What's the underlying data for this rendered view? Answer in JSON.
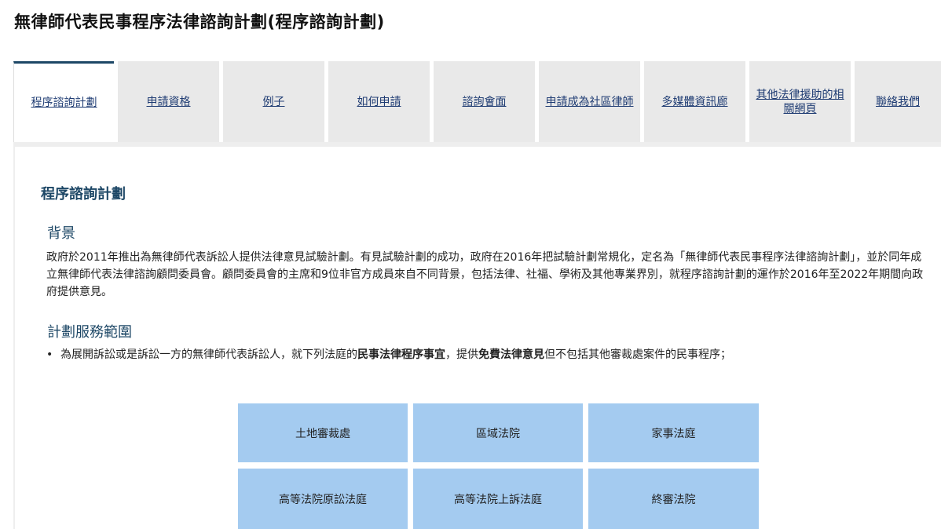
{
  "page": {
    "title": "無律師代表民事程序法律諮詢計劃(程序諮詢計劃)"
  },
  "tabs": [
    {
      "label": "程序諮詢計劃",
      "active": true
    },
    {
      "label": "申請資格",
      "active": false
    },
    {
      "label": "例子",
      "active": false
    },
    {
      "label": "如何申請",
      "active": false
    },
    {
      "label": "諮詢會面",
      "active": false
    },
    {
      "label": "申請成為社區律師",
      "active": false
    },
    {
      "label": "多媒體資訊廊",
      "active": false
    },
    {
      "label": "其他法律援助的相關網頁",
      "active": false
    },
    {
      "label": "聯絡我們",
      "active": false
    }
  ],
  "content": {
    "heading": "程序諮詢計劃",
    "background": {
      "title": "背景",
      "text": "政府於2011年推出為無律師代表訴訟人提供法律意見試驗計劃。有見試驗計劃的成功，政府在2016年把試驗計劃常規化，定名為「無律師代表民事程序法律諮詢計劃」，並於同年成立無律師代表法律諮詢顧問委員會。顧問委員會的主席和9位非官方成員來自不同背景，包括法律、社福、學術及其他專業界別，就程序諮詢計劃的運作於2016年至2022年期間向政府提供意見。"
    },
    "scope": {
      "title": "計劃服務範圍",
      "bullet": {
        "part1": "為展開訴訟或是訴訟一方的無律師代表訴訟人，就下列法庭的",
        "bold1": "民事法律程序事宜",
        "part2": "，提供",
        "bold2": "免費法律意見",
        "part3": "但不包括其他審裁處案件的民事程序；"
      },
      "courts": [
        "土地審裁處",
        "區域法院",
        "家事法庭",
        "高等法院原訟法庭",
        "高等法院上訴法庭",
        "終審法院"
      ]
    }
  },
  "colors": {
    "tab_bg": "#e9e9e9",
    "active_border": "#1d4766",
    "link": "#1f3c73",
    "heading": "#1d4766",
    "court_box": "#a4cbf0"
  }
}
